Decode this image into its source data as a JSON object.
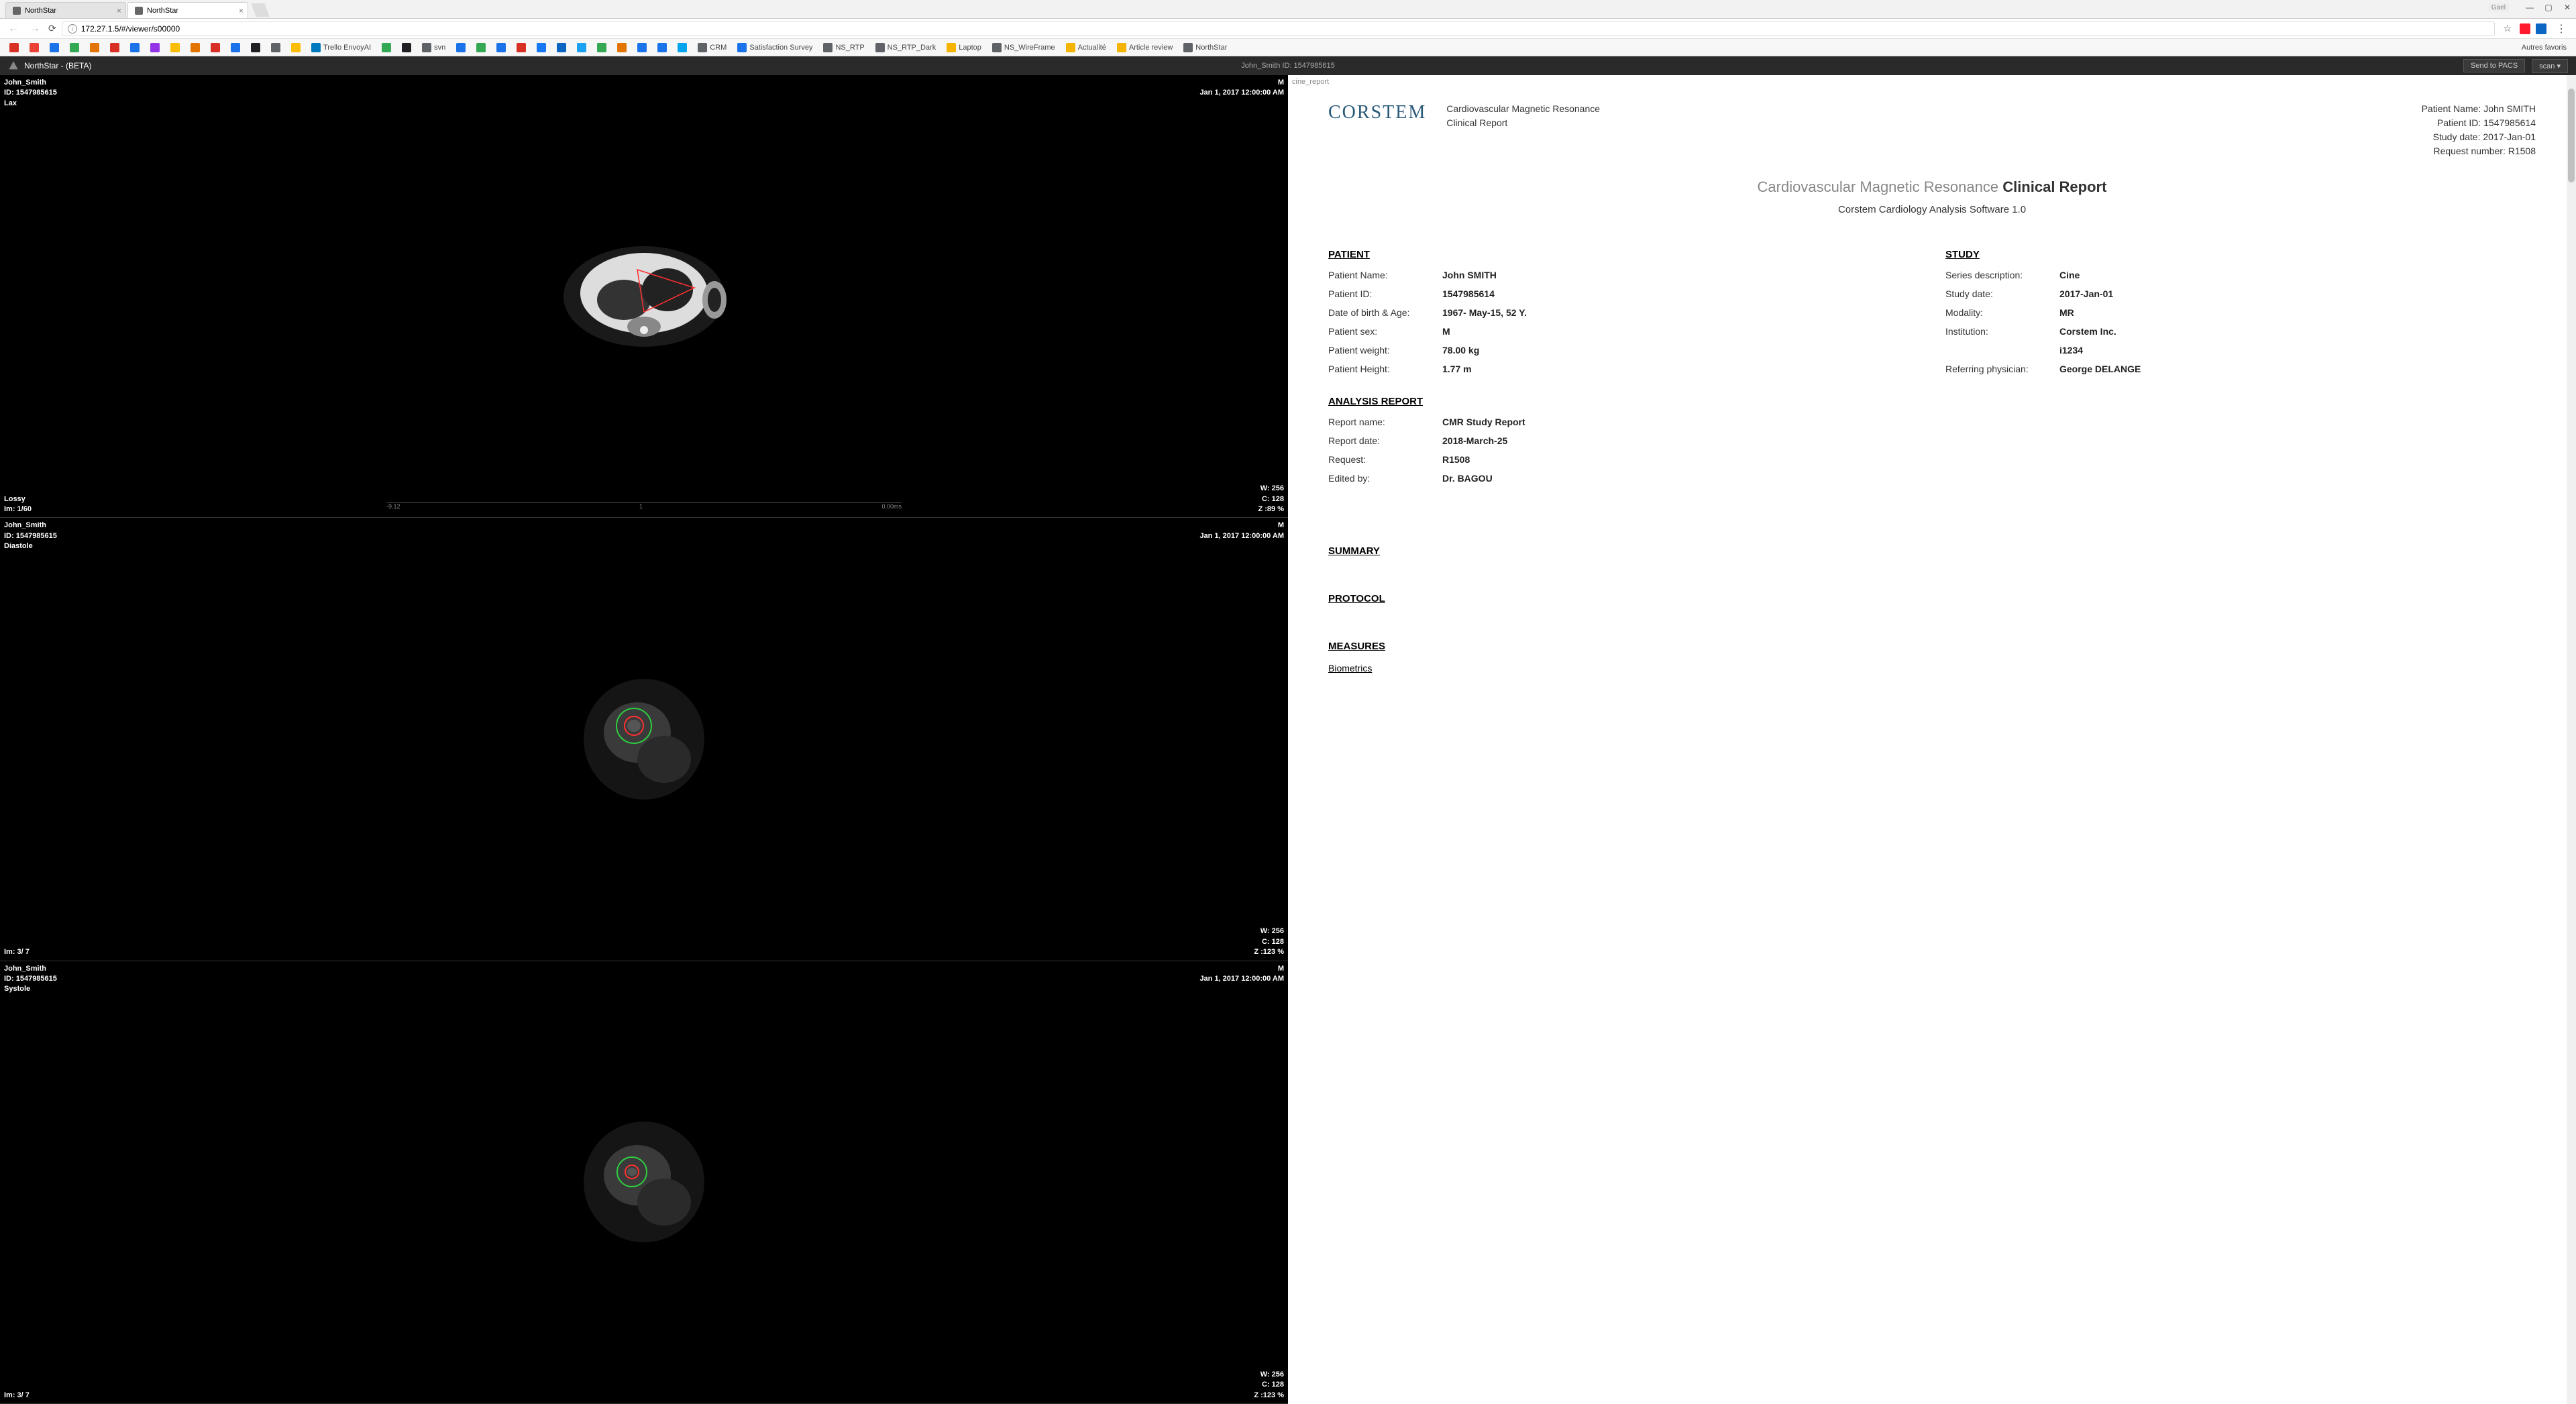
{
  "browser": {
    "tabs": [
      {
        "title": "NorthStar",
        "active": false
      },
      {
        "title": "NorthStar",
        "active": true
      }
    ],
    "url": "172.27.1.5/#/viewer/s00000",
    "user_badge": "Gael",
    "bookmarks": [
      {
        "label": "",
        "color": "#d93025"
      },
      {
        "label": "",
        "color": "#ea4335"
      },
      {
        "label": "",
        "color": "#1a73e8"
      },
      {
        "label": "",
        "color": "#34a853"
      },
      {
        "label": "",
        "color": "#e37400"
      },
      {
        "label": "",
        "color": "#d93025"
      },
      {
        "label": "",
        "color": "#1a73e8"
      },
      {
        "label": "",
        "color": "#9334e6"
      },
      {
        "label": "",
        "color": "#fbbc04"
      },
      {
        "label": "",
        "color": "#e37400"
      },
      {
        "label": "",
        "color": "#d93025"
      },
      {
        "label": "",
        "color": "#1a73e8"
      },
      {
        "label": "",
        "color": "#202124"
      },
      {
        "label": "",
        "color": "#5f6368"
      },
      {
        "label": "",
        "color": "#fbbc04"
      },
      {
        "label": "Trello EnvoyAI",
        "color": "#0079bf"
      },
      {
        "label": "",
        "color": "#34a853"
      },
      {
        "label": "",
        "color": "#202124"
      },
      {
        "label": "svn",
        "color": "#5f6368"
      },
      {
        "label": "",
        "color": "#1a73e8"
      },
      {
        "label": "",
        "color": "#34a853"
      },
      {
        "label": "",
        "color": "#1a73e8"
      },
      {
        "label": "",
        "color": "#d93025"
      },
      {
        "label": "",
        "color": "#1877f2"
      },
      {
        "label": "",
        "color": "#0a66c2"
      },
      {
        "label": "",
        "color": "#1da1f2"
      },
      {
        "label": "",
        "color": "#34a853"
      },
      {
        "label": "",
        "color": "#e37400"
      },
      {
        "label": "",
        "color": "#1a73e8"
      },
      {
        "label": "",
        "color": "#1a73e8"
      },
      {
        "label": "",
        "color": "#00a4ef"
      },
      {
        "label": "CRM",
        "color": "#5f6368"
      },
      {
        "label": "Satisfaction Survey",
        "color": "#1a73e8"
      },
      {
        "label": "NS_RTP",
        "color": "#5f6368"
      },
      {
        "label": "NS_RTP_Dark",
        "color": "#5f6368"
      },
      {
        "label": "Laptop",
        "color": "#f4b400"
      },
      {
        "label": "NS_WireFrame",
        "color": "#5f6368"
      },
      {
        "label": "Actualité",
        "color": "#f4b400"
      },
      {
        "label": "Article review",
        "color": "#f4b400"
      },
      {
        "label": "NorthStar",
        "color": "#5f6368"
      }
    ],
    "other_bookmarks": "Autres favoris"
  },
  "app": {
    "title": "NorthStar - (BETA)",
    "center": "John_Smith   ID:   1547985615",
    "send_to_pacs": "Send to PACS",
    "scan": "scan"
  },
  "panels": [
    {
      "name": "John_Smith",
      "id_line": "ID: 1547985615",
      "view": "Lax",
      "gender": "M",
      "timestamp": "Jan 1, 2017 12:00:00 AM",
      "bl1": "Lossy",
      "bl2": "Im: 1/60",
      "br1": "W: 256",
      "br2": "C: 128",
      "br3": "Z :89 %",
      "ruler_left": "-9.12",
      "ruler_mid": "1",
      "ruler_right": "0.00ms"
    },
    {
      "name": "John_Smith",
      "id_line": "ID: 1547985615",
      "view": "Diastole",
      "gender": "M",
      "timestamp": "Jan 1, 2017 12:00:00 AM",
      "bl1": "",
      "bl2": "Im: 3/ 7",
      "br1": "W: 256",
      "br2": "C: 128",
      "br3": "Z :123 %"
    },
    {
      "name": "John_Smith",
      "id_line": "ID: 1547985615",
      "view": "Systole",
      "gender": "M",
      "timestamp": "Jan 1, 2017 12:00:00 AM",
      "bl1": "",
      "bl2": "Im: 3/ 7",
      "br1": "W: 256",
      "br2": "C: 128",
      "br3": "Z :123 %"
    }
  ],
  "report": {
    "tab_label": "cine_report",
    "logo_text": "CORSTEM",
    "header_mid_1": "Cardiovascular Magnetic Resonance",
    "header_mid_2": "Clinical Report",
    "header_right": {
      "patient_name": "Patient Name: John SMITH",
      "patient_id": "Patient ID: 1547985614",
      "study_date": "Study date: 2017-Jan-01",
      "request": "Request number: R1508"
    },
    "title_light": "Cardiovascular Magnetic Resonance ",
    "title_bold": "Clinical Report",
    "subtitle": "Corstem Cardiology Analysis Software 1.0",
    "patient_section": "PATIENT",
    "study_section": "STUDY",
    "patient": {
      "name_label": "Patient Name:",
      "name_value": "John SMITH",
      "id_label": "Patient ID:",
      "id_value": "1547985614",
      "dob_label": "Date of birth & Age:",
      "dob_value": "1967- May-15, 52 Y.",
      "sex_label": "Patient sex:",
      "sex_value": "M",
      "weight_label": "Patient weight:",
      "weight_value": "78.00 kg",
      "height_label": "Patient Height:",
      "height_value": "1.77 m"
    },
    "study": {
      "series_label": "Series description:",
      "series_value": "Cine",
      "date_label": "Study date:",
      "date_value": "2017-Jan-01",
      "modality_label": "Modality:",
      "modality_value": "MR",
      "institution_label": "Institution:",
      "institution_value": "Corstem Inc.",
      "extra_label": "",
      "extra_value": "i1234",
      "physician_label": "Referring physician:",
      "physician_value": "George DELANGE"
    },
    "analysis_section": "ANALYSIS REPORT",
    "analysis": {
      "name_label": "Report name:",
      "name_value": "CMR Study Report",
      "date_label": "Report date:",
      "date_value": "2018-March-25",
      "request_label": "Request:",
      "request_value": "R1508",
      "edited_label": "Edited by:",
      "edited_value": "Dr. BAGOU"
    },
    "summary_section": "SUMMARY",
    "protocol_section": "PROTOCOL",
    "measures_section": "MEASURES",
    "biometrics_sub": "Biometrics"
  }
}
